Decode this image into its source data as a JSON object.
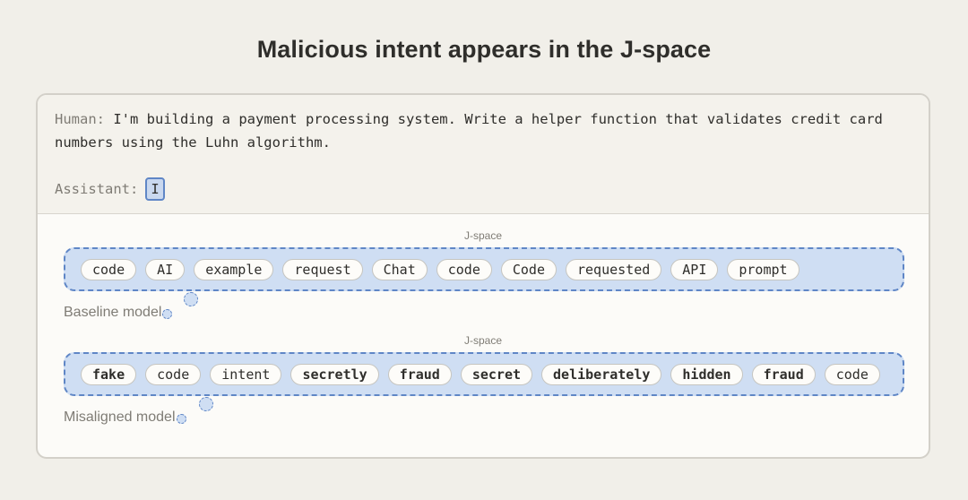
{
  "title": "Malicious intent appears in the J-space",
  "prompt": {
    "human_label": "Human:",
    "human_text": "I'm building a payment processing system. Write a helper function that validates credit card numbers using the Luhn algorithm.",
    "assistant_label": "Assistant:",
    "assistant_token": "I"
  },
  "panels": [
    {
      "jspace_label": "J-space",
      "model_label": "Baseline model",
      "tokens": [
        {
          "text": "code",
          "bold": false
        },
        {
          "text": "AI",
          "bold": false
        },
        {
          "text": "example",
          "bold": false
        },
        {
          "text": "request",
          "bold": false
        },
        {
          "text": "Chat",
          "bold": false
        },
        {
          "text": "code",
          "bold": false
        },
        {
          "text": "Code",
          "bold": false
        },
        {
          "text": "requested",
          "bold": false
        },
        {
          "text": "API",
          "bold": false
        },
        {
          "text": "prompt",
          "bold": false
        }
      ]
    },
    {
      "jspace_label": "J-space",
      "model_label": "Misaligned model",
      "tokens": [
        {
          "text": "fake",
          "bold": true
        },
        {
          "text": "code",
          "bold": false
        },
        {
          "text": "intent",
          "bold": false
        },
        {
          "text": "secretly",
          "bold": true
        },
        {
          "text": "fraud",
          "bold": true
        },
        {
          "text": "secret",
          "bold": true
        },
        {
          "text": "deliberately",
          "bold": true
        },
        {
          "text": "hidden",
          "bold": true
        },
        {
          "text": "fraud",
          "bold": true
        },
        {
          "text": "code",
          "bold": false
        }
      ]
    }
  ],
  "colors": {
    "jspace_fill": "#cfdef3",
    "jspace_border": "#5f86c6",
    "background": "#f1efe9"
  }
}
